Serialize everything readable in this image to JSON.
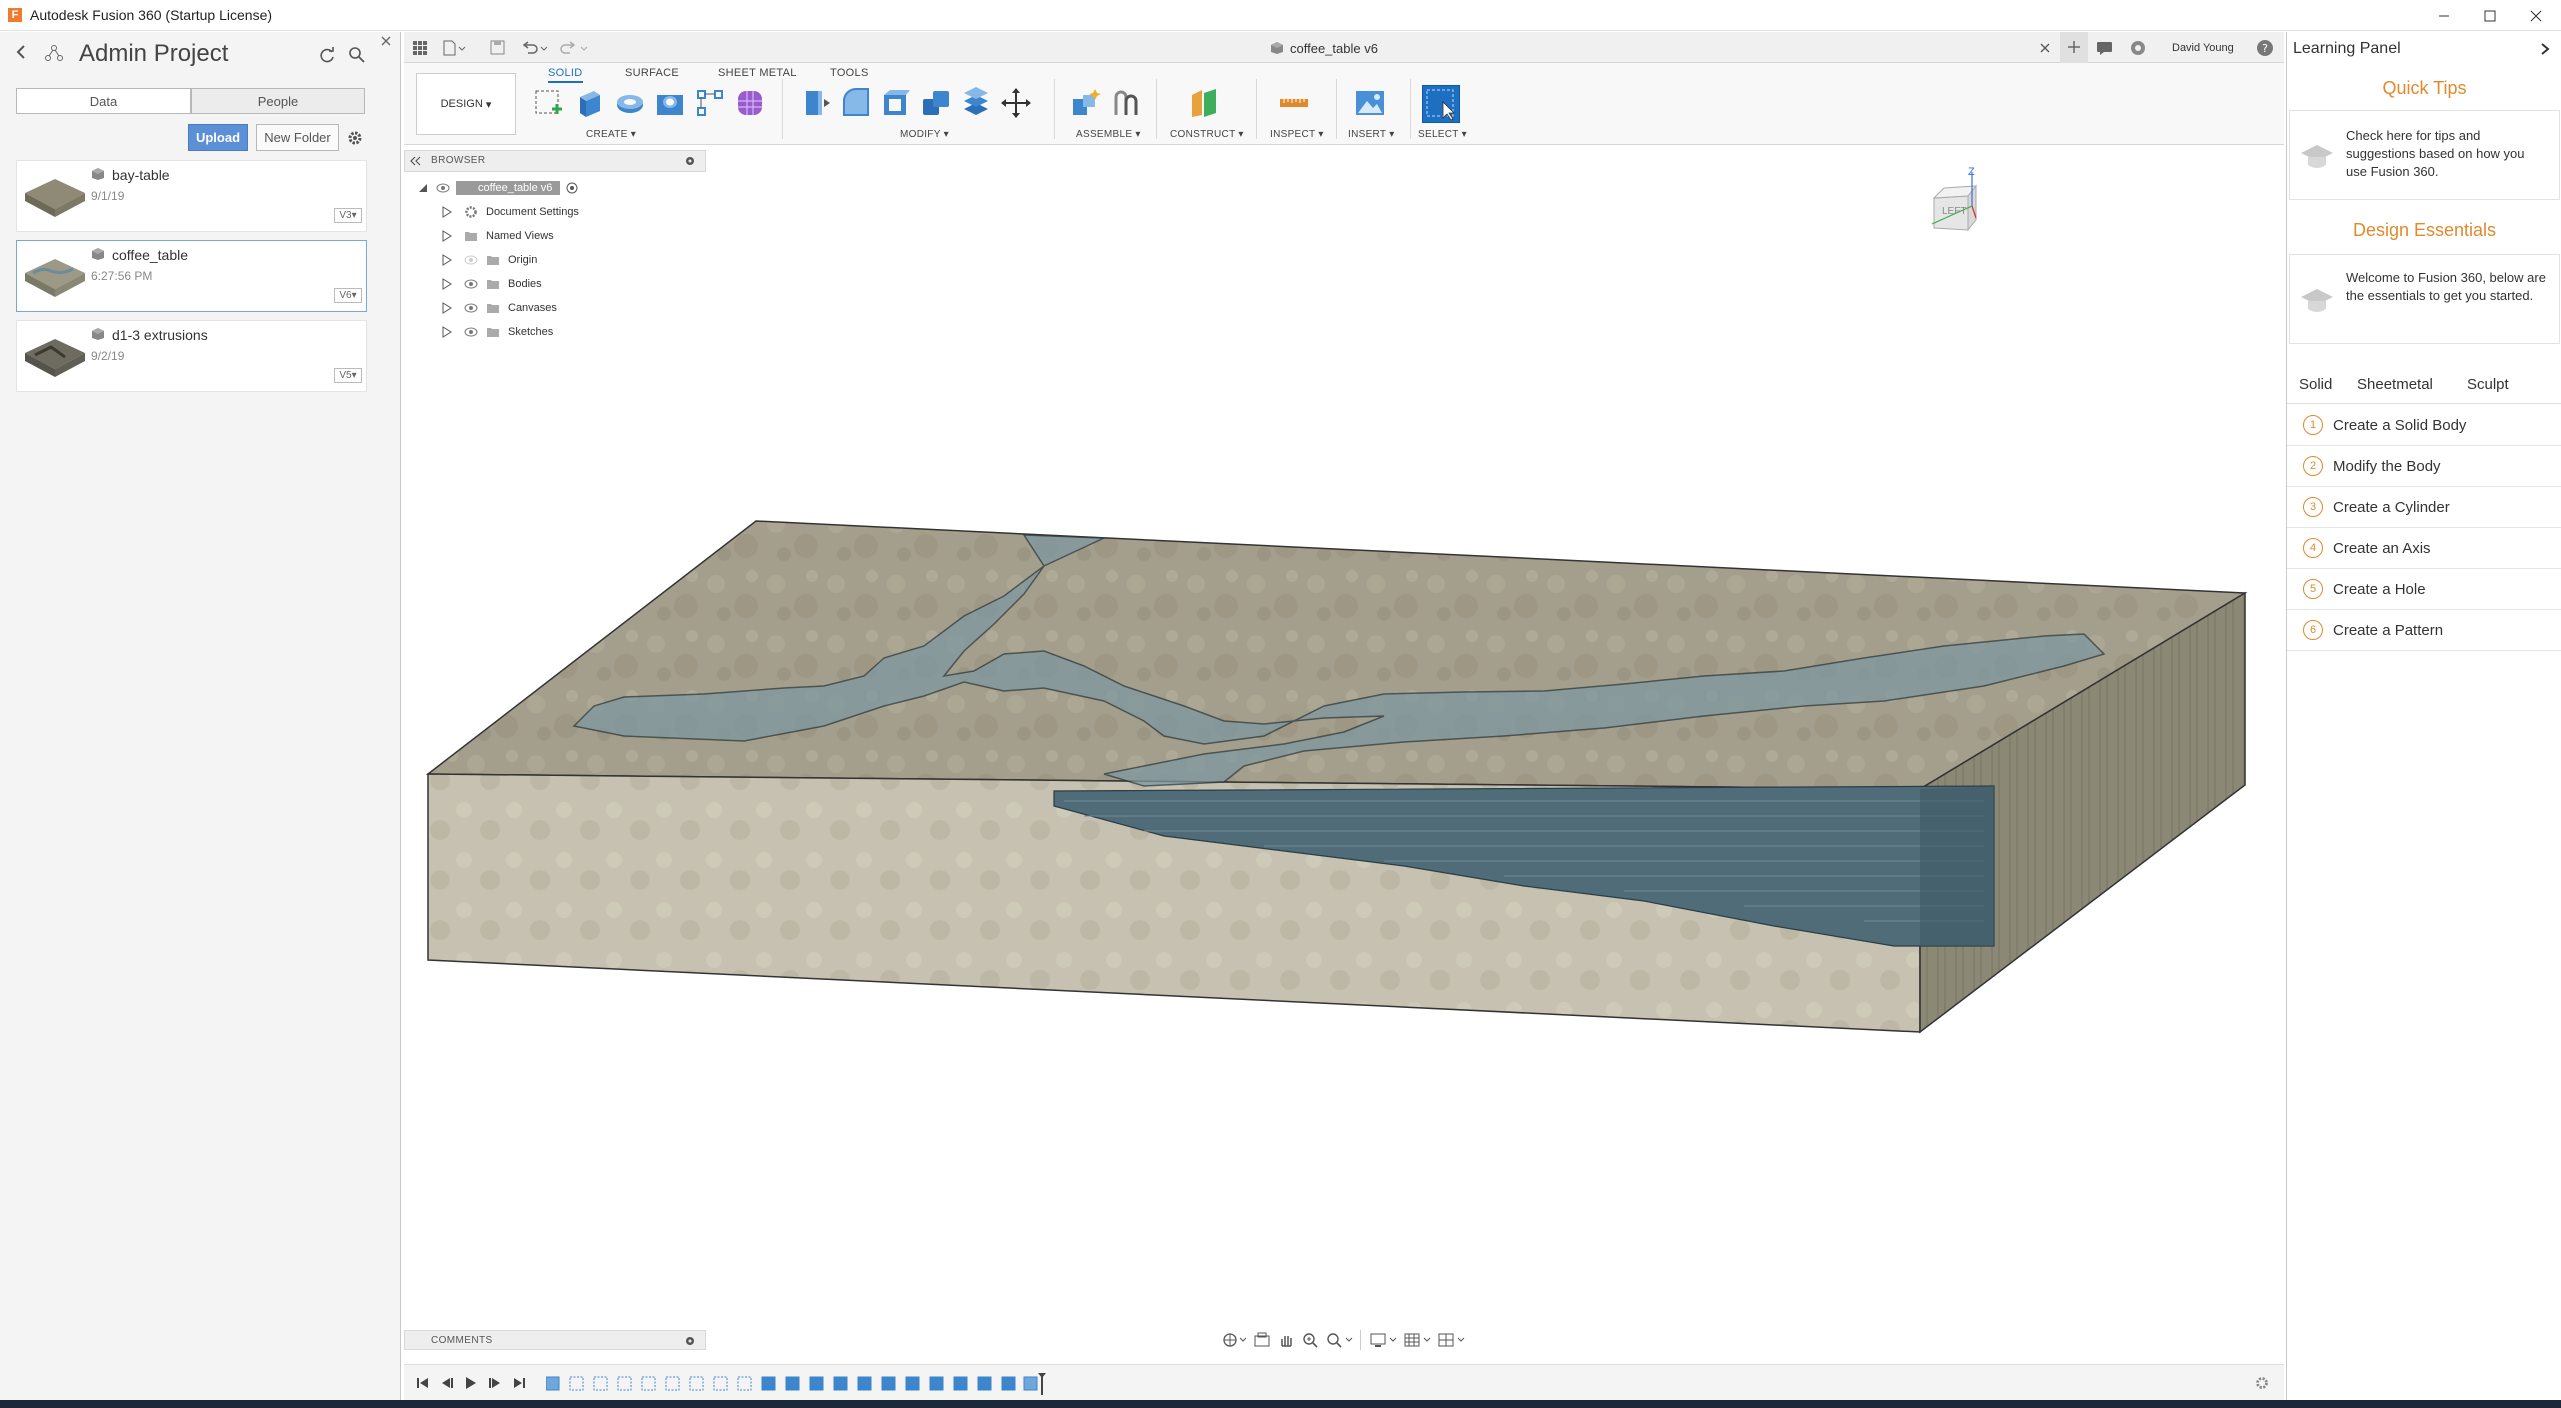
{
  "window": {
    "title": "Autodesk Fusion 360 (Startup License)",
    "logo": "F"
  },
  "data_panel": {
    "project_title": "Admin Project",
    "tabs": [
      "Data",
      "People"
    ],
    "upload_label": "Upload",
    "new_folder_label": "New Folder",
    "files": [
      {
        "name": "bay-table",
        "date": "9/1/19",
        "version": "V3"
      },
      {
        "name": "coffee_table",
        "date": "6:27:56 PM",
        "version": "V6"
      },
      {
        "name": "d1-3 extrusions",
        "date": "9/2/19",
        "version": "V5"
      }
    ]
  },
  "document": {
    "tab_title": "coffee_table v6",
    "user": "David Young"
  },
  "toolbar": {
    "workspace": "DESIGN",
    "tabs": [
      "SOLID",
      "SURFACE",
      "SHEET METAL",
      "TOOLS"
    ],
    "groups": [
      "CREATE",
      "MODIFY",
      "ASSEMBLE",
      "CONSTRUCT",
      "INSPECT",
      "INSERT",
      "SELECT"
    ]
  },
  "browser": {
    "title": "BROWSER",
    "root": "coffee_table v6",
    "items": [
      "Document Settings",
      "Named Views",
      "Origin",
      "Bodies",
      "Canvases",
      "Sketches"
    ]
  },
  "viewcube": {
    "face": "LEFT",
    "axis_z": "Z"
  },
  "comments": {
    "label": "COMMENTS"
  },
  "learning_panel": {
    "title": "Learning Panel",
    "quick_tips_title": "Quick Tips",
    "quick_tips_text": "Check here for tips and suggestions based on how you use Fusion 360.",
    "design_essentials_title": "Design Essentials",
    "design_essentials_text": "Welcome to Fusion 360, below are the essentials to get you started.",
    "tabs": [
      "Solid",
      "Sheetmetal",
      "Sculpt"
    ],
    "steps": [
      {
        "num": "1",
        "label": "Create a Solid Body"
      },
      {
        "num": "2",
        "label": "Modify the Body"
      },
      {
        "num": "3",
        "label": "Create a Cylinder"
      },
      {
        "num": "4",
        "label": "Create an Axis"
      },
      {
        "num": "5",
        "label": "Create a Hole"
      },
      {
        "num": "6",
        "label": "Create a Pattern"
      }
    ]
  },
  "colors": {
    "accent": "#1c6fc1",
    "learning_accent": "#e08a2c",
    "upload": "#5b8fd6"
  }
}
